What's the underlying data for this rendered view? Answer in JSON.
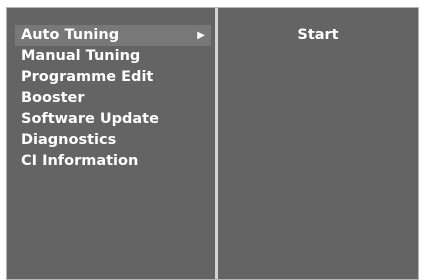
{
  "menu": {
    "items": [
      {
        "label": "Auto Tuning",
        "selected": true,
        "has_submenu": true,
        "arrow": "▶"
      },
      {
        "label": "Manual Tuning"
      },
      {
        "label": "Programme Edit"
      },
      {
        "label": "Booster"
      },
      {
        "label": "Software Update"
      },
      {
        "label": "Diagnostics"
      },
      {
        "label": "CI Information"
      }
    ]
  },
  "submenu": {
    "items": [
      {
        "label": "Start"
      }
    ]
  },
  "colors": {
    "panel_background": "#646464",
    "selected_background": "#787878",
    "divider": "#d2d2d2",
    "text": "#ffffff"
  },
  "icons": {
    "submenu_arrow": "triangle-right-icon"
  }
}
